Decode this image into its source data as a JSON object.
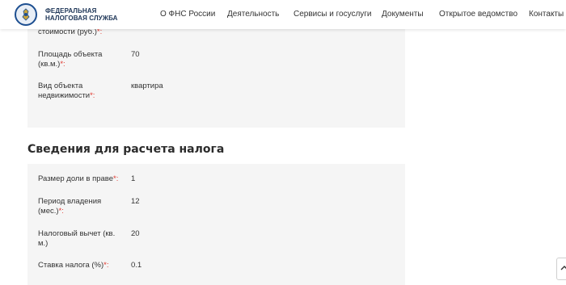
{
  "header": {
    "logo_line1": "ФЕДЕРАЛЬНАЯ",
    "logo_line2": "НАЛОГОВАЯ СЛУЖБА",
    "nav": [
      "О ФНС России",
      "Деятельность",
      "Сервисы и госуслуги",
      "Документы",
      "Открытое ведомство",
      "Контакты"
    ]
  },
  "object_section": {
    "rows": [
      {
        "label": "стоимости (руб.)",
        "required": "*:",
        "value": ""
      },
      {
        "label": "Площадь объекта (кв.м.)",
        "required": "*:",
        "value": "70"
      },
      {
        "label": "Вид объекта недвижимости",
        "required": "*:",
        "value": "квартира"
      }
    ]
  },
  "tax_section": {
    "title": "Сведения для расчета налога",
    "rows": [
      {
        "label": "Размер доли в праве",
        "required": "*:",
        "value": "1"
      },
      {
        "label": "Период владения (мес.)",
        "required": "*:",
        "value": "12"
      },
      {
        "label": "Налоговый вычет (кв. м.)",
        "required": "",
        "value": "20"
      },
      {
        "label": "Ставка налога (%)",
        "required": "*:",
        "value": "0.1"
      }
    ]
  },
  "icons": {
    "logo": "fns-emblem-icon",
    "scroll_top": "arrow-up-icon"
  },
  "colors": {
    "required_marker": "#e0362c",
    "panel_bg": "#f5f5f5",
    "logo_blue": "#1d4f91"
  }
}
